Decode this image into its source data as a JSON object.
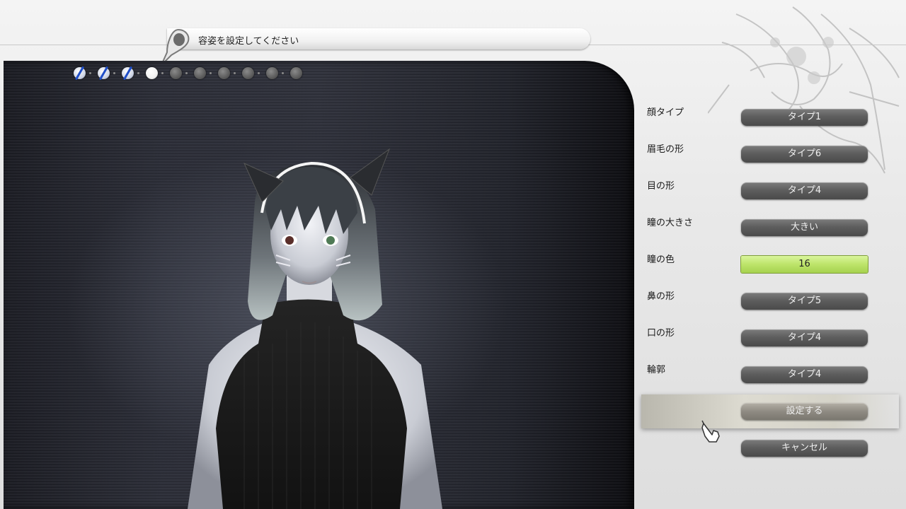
{
  "header": {
    "instruction": "容姿を設定してください"
  },
  "progress": {
    "total_steps": 10,
    "completed_steps": 3,
    "current_step": 4
  },
  "settings": [
    {
      "label": "顔タイプ",
      "value": "タイプ1"
    },
    {
      "label": "眉毛の形",
      "value": "タイプ6"
    },
    {
      "label": "目の形",
      "value": "タイプ4"
    },
    {
      "label": "瞳の大きさ",
      "value": "大きい"
    },
    {
      "label": "瞳の色",
      "value": "16",
      "selected": true
    },
    {
      "label": "鼻の形",
      "value": "タイプ5"
    },
    {
      "label": "口の形",
      "value": "タイプ4"
    },
    {
      "label": "輪郭",
      "value": "タイプ4"
    }
  ],
  "actions": {
    "confirm_label": "設定する",
    "cancel_label": "キャンセル"
  },
  "colors": {
    "selected_value_bg": "#bde46a",
    "value_button_bg": "#5e5e5e"
  },
  "icons": [
    "pin-icon",
    "hand-cursor-icon",
    "decorative-art-icon"
  ]
}
